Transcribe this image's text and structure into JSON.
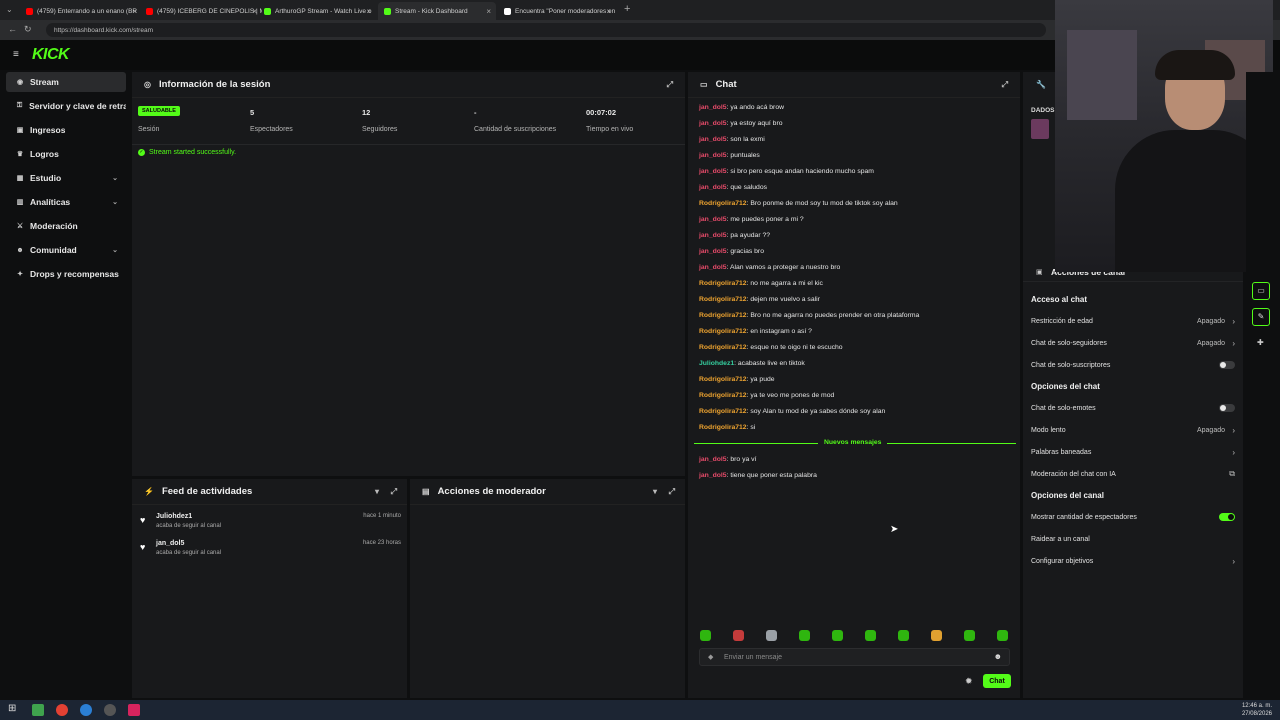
{
  "browser": {
    "tabs": [
      {
        "label": "(4759) Enterrando a un enano (BR",
        "fav": "#ff0000"
      },
      {
        "label": "(4759) ICEBERG DE CINEPOLIS | M",
        "fav": "#ff0000"
      },
      {
        "label": "ArthuroGP Stream - Watch Live o",
        "fav": "#53fc18"
      },
      {
        "label": "Stream - Kick Dashboard",
        "fav": "#53fc18"
      },
      {
        "label": "Encuentra \"Poner moderadores en",
        "fav": "#ffffff"
      }
    ],
    "url": "https://dashboard.kick.com/stream"
  },
  "app": {
    "logo": "KICK"
  },
  "sidebar": {
    "items": [
      {
        "label": "Stream",
        "icon": "broadcast-icon"
      },
      {
        "label": "Servidor y clave de retrans",
        "icon": "key-icon"
      },
      {
        "label": "Ingresos",
        "icon": "money-icon"
      },
      {
        "label": "Logros",
        "icon": "trophy-icon"
      },
      {
        "label": "Estudio",
        "icon": "studio-icon"
      },
      {
        "label": "Analíticas",
        "icon": "chart-icon"
      },
      {
        "label": "Moderación",
        "icon": "sword-icon"
      },
      {
        "label": "Comunidad",
        "icon": "people-icon"
      },
      {
        "label": "Drops y recompensas",
        "icon": "gift-icon"
      }
    ]
  },
  "session": {
    "title": "Información de la sesión",
    "badge": "SALUDABLE",
    "badge_label": "Sesión",
    "stats": [
      {
        "value": "5",
        "label": "Espectadores"
      },
      {
        "value": "12",
        "label": "Seguidores"
      },
      {
        "value": "-",
        "label": "Cantidad de suscripciones"
      },
      {
        "value": "00:07:02",
        "label": "Tiempo en vivo"
      }
    ],
    "status_message": "Stream started successfully."
  },
  "chat": {
    "title": "Chat",
    "messages": [
      {
        "user": "jan_dol5",
        "text": ": ya ando acá brow",
        "color": "#e84b6a"
      },
      {
        "user": "jan_dol5",
        "text": ": ya estoy aquí bro",
        "color": "#e84b6a"
      },
      {
        "user": "jan_dol5",
        "text": ": son la exmi",
        "color": "#e84b6a"
      },
      {
        "user": "jan_dol5",
        "text": ": puntuales",
        "color": "#e84b6a"
      },
      {
        "user": "jan_dol5",
        "text": ": si bro pero esque andan haciendo mucho spam",
        "color": "#e84b6a"
      },
      {
        "user": "jan_dol5",
        "text": ": que saludos",
        "color": "#e84b6a"
      },
      {
        "user": "Rodrigolira712",
        "text": ": Bro ponme de mod soy tu mod de tiktok soy alan",
        "color": "#f0a530"
      },
      {
        "user": "jan_dol5",
        "text": ": me puedes poner a mi ?",
        "color": "#e84b6a"
      },
      {
        "user": "jan_dol5",
        "text": ": pa ayudar ??",
        "color": "#e84b6a"
      },
      {
        "user": "jan_dol5",
        "text": ": gracias bro",
        "color": "#e84b6a"
      },
      {
        "user": "jan_dol5",
        "text": ": Alan vamos a proteger a nuestro bro",
        "color": "#e84b6a"
      },
      {
        "user": "Rodrigolira712",
        "text": ": no me agarra a mi el kic",
        "color": "#f0a530"
      },
      {
        "user": "Rodrigolira712",
        "text": ": dejen me vuelvo a salir",
        "color": "#f0a530"
      },
      {
        "user": "Rodrigolira712",
        "text": ": Bro no me agarra no puedes prender en otra plataforma",
        "color": "#f0a530"
      },
      {
        "user": "Rodrigolira712",
        "text": ": en instagram o así ?",
        "color": "#f0a530"
      },
      {
        "user": "Rodrigolira712",
        "text": ": esque no te oigo ni te escucho",
        "color": "#f0a530"
      },
      {
        "user": "Juliohdez1",
        "text": ": acabaste live en tiktok",
        "color": "#35d0a0"
      },
      {
        "user": "Rodrigolira712",
        "text": ": ya pude",
        "color": "#f0a530"
      },
      {
        "user": "Rodrigolira712",
        "text": ": ya te veo me pones de mod",
        "color": "#f0a530"
      },
      {
        "user": "Rodrigolira712",
        "text": ": soy Alan tu mod de ya sabes dónde soy alan",
        "color": "#f0a530"
      },
      {
        "user": "Rodrigolira712",
        "text": ": si",
        "color": "#f0a530"
      }
    ],
    "new_messages_label": "Nuevos mensajes",
    "new_messages": [
      {
        "user": "jan_dol5",
        "text": ": bro ya ví",
        "color": "#e84b6a"
      },
      {
        "user": "jan_dol5",
        "text": ": tiene que poner esta palabra",
        "color": "#e84b6a"
      }
    ],
    "input_placeholder": "Enviar un mensaje",
    "send_label": "Chat"
  },
  "activity": {
    "title": "Feed de actividades",
    "items": [
      {
        "user": "Juliohdez1",
        "action": "acaba de seguir al canal",
        "time": "hace 1 minuto"
      },
      {
        "user": "jan_dol5",
        "action": "acaba de seguir al canal",
        "time": "hace 23 horas"
      }
    ]
  },
  "mod_actions": {
    "title": "Acciones de moderador"
  },
  "channel_actions": {
    "title": "Acciones de canal",
    "dados_label": "DADOS",
    "sections": [
      {
        "title": "Acceso al chat",
        "rows": [
          {
            "label": "Restricción de edad",
            "value": "Apagado",
            "kind": "arrow"
          },
          {
            "label": "Chat de solo-seguidores",
            "value": "Apagado",
            "kind": "arrow"
          },
          {
            "label": "Chat de solo-suscriptores",
            "value": "",
            "kind": "toggle-off"
          }
        ]
      },
      {
        "title": "Opciones del chat",
        "rows": [
          {
            "label": "Chat de solo-emotes",
            "value": "",
            "kind": "toggle-off"
          },
          {
            "label": "Modo lento",
            "value": "Apagado",
            "kind": "arrow"
          },
          {
            "label": "Palabras baneadas",
            "value": "",
            "kind": "arrow"
          },
          {
            "label": "Moderación del chat con IA",
            "value": "",
            "kind": "external"
          }
        ]
      },
      {
        "title": "Opciones del canal",
        "rows": [
          {
            "label": "Mostrar cantidad de espectadores",
            "value": "",
            "kind": "toggle-on"
          },
          {
            "label": "Raidear a un canal",
            "value": "",
            "kind": "none"
          },
          {
            "label": "Configurar objetivos",
            "value": "",
            "kind": "arrow"
          }
        ]
      }
    ]
  },
  "taskbar": {
    "time": "12:46 a. m.",
    "date": "27/08/2026"
  }
}
